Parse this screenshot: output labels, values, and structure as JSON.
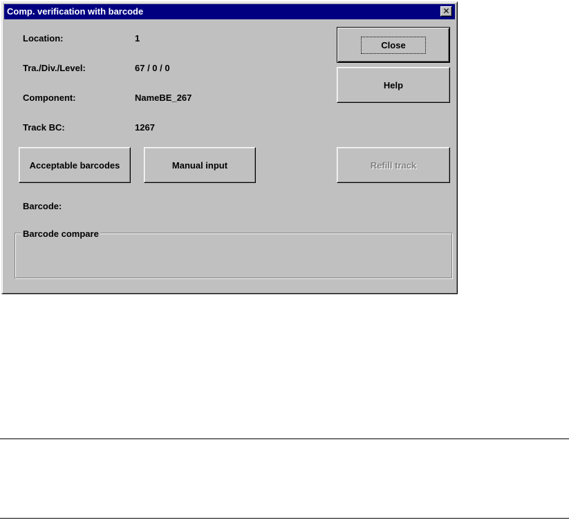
{
  "window": {
    "title": "Comp. verification with barcode",
    "close_glyph": "✕"
  },
  "fields": {
    "location_label": "Location:",
    "location_value": "1",
    "tra_label": "Tra./Div./Level:",
    "tra_value": "67 / 0 / 0",
    "component_label": "Component:",
    "component_value": "NameBE_267",
    "trackbc_label": "Track BC:",
    "trackbc_value": "1267",
    "barcode_label": "Barcode:"
  },
  "buttons": {
    "close": "Close",
    "help": "Help",
    "acceptable": "Acceptable barcodes",
    "manual": "Manual input",
    "refill": "Refill track"
  },
  "group": {
    "title": "Barcode compare"
  },
  "colors": {
    "face": "#c0c0c0",
    "titlebar": "#000080",
    "disabled_text": "#808080"
  }
}
